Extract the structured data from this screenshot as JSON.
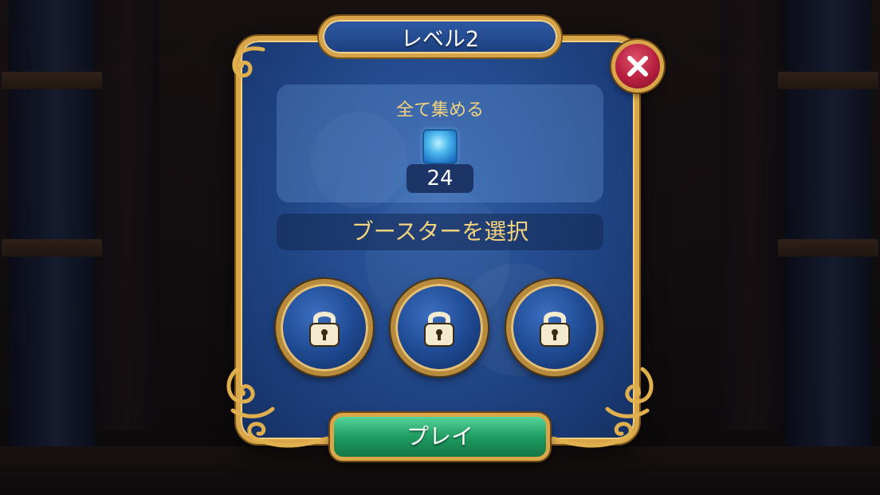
{
  "dialog": {
    "title": "レベル2"
  },
  "goal": {
    "title": "全て集める",
    "item_icon": "blue-gem-icon",
    "count": "24"
  },
  "boosters": {
    "header": "ブースターを選択",
    "slots": [
      {
        "state": "locked",
        "icon": "lock-icon"
      },
      {
        "state": "locked",
        "icon": "lock-icon"
      },
      {
        "state": "locked",
        "icon": "lock-icon"
      }
    ]
  },
  "actions": {
    "play_label": "プレイ",
    "close_icon": "close-icon"
  },
  "colors": {
    "panel_blue": "#234a8c",
    "gold_frame": "#d9a64a",
    "label_gold": "#f5d27d",
    "play_green": "#1f9d63",
    "close_red": "#b51f3d"
  }
}
